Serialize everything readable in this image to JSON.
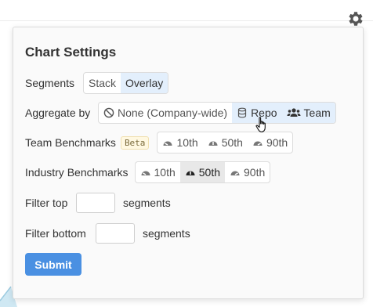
{
  "panel": {
    "title": "Chart Settings",
    "segments": {
      "label": "Segments",
      "options": [
        "Stack",
        "Overlay"
      ],
      "selected": "Overlay"
    },
    "aggregate": {
      "label": "Aggregate by",
      "options": [
        {
          "label": "None (Company-wide)",
          "icon": "ban-icon"
        },
        {
          "label": "Repo",
          "icon": "database-icon"
        },
        {
          "label": "Team",
          "icon": "users-icon"
        }
      ],
      "selected": [
        "Repo",
        "Team"
      ]
    },
    "team_benchmarks": {
      "label": "Team Benchmarks",
      "badge": "Beta",
      "options": [
        "10th",
        "50th",
        "90th"
      ],
      "icon": "gauge-icon"
    },
    "industry_benchmarks": {
      "label": "Industry Benchmarks",
      "options": [
        "10th",
        "50th",
        "90th"
      ],
      "selected": "50th",
      "icon": "gauge-icon"
    },
    "filter_top": {
      "label": "Filter top",
      "value": "",
      "suffix": "segments"
    },
    "filter_bottom": {
      "label": "Filter bottom",
      "value": "",
      "suffix": "segments"
    },
    "submit_label": "Submit"
  },
  "colors": {
    "accent": "#4a90e2",
    "active_bg": "#e3effc",
    "gear": "#555555"
  }
}
